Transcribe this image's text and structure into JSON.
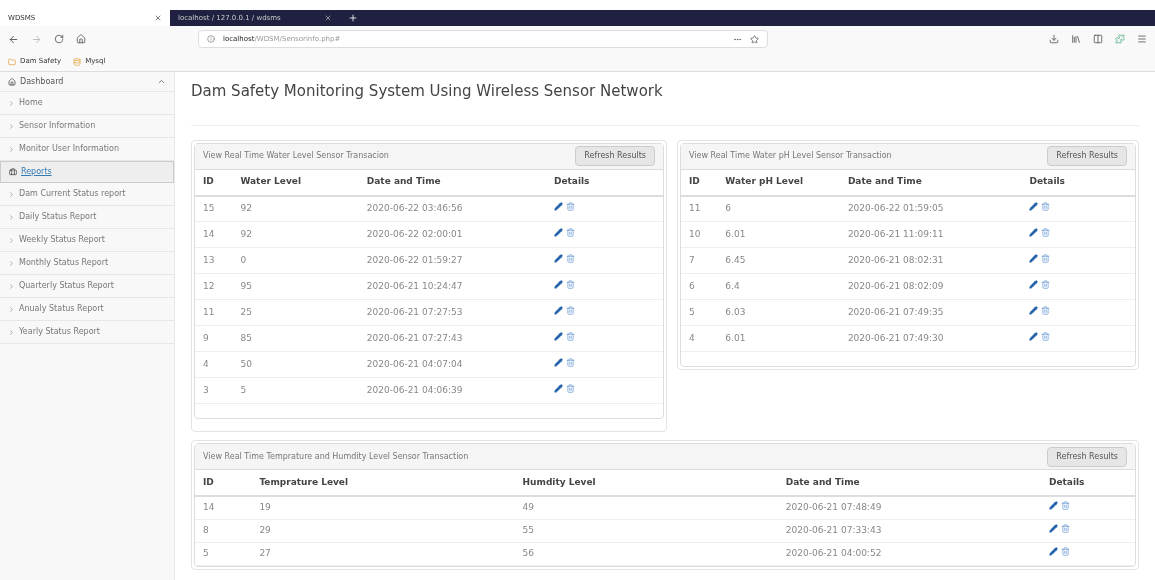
{
  "browser": {
    "tabs": [
      {
        "label": "WDSMS",
        "selected": true
      },
      {
        "label": "localhost / 127.0.0.1 / wdsms",
        "selected": false
      }
    ],
    "address": {
      "host": "localhost",
      "path": "/WDSM/Sensorinfo.php#"
    },
    "bookmarks": [
      "Dam Safety",
      "Mysql"
    ]
  },
  "sidebar": {
    "sections": [
      {
        "label": "Dashboard",
        "selected": false,
        "expanded": true,
        "items": [
          "Home",
          "Sensor Information",
          "Monitor User Information"
        ]
      },
      {
        "label": "Reports",
        "selected": true,
        "items": [
          "Dam Current Status report",
          "Daily Status Report",
          "Weekly Status Report",
          "Monthly Status Report",
          "Quarterly Status Report",
          "Anualy Status Report",
          "Yearly Status Report"
        ]
      }
    ]
  },
  "page_title": "Dam Safety Monitoring System Using Wireless Sensor Network",
  "panels": [
    {
      "title": "View Real Time Water Level Sensor Transacion",
      "button": "Refresh Results",
      "columns": [
        "ID",
        "Water Level",
        "Date and Time",
        "Details"
      ],
      "rows": [
        [
          "15",
          "92",
          "2020-06-22 03:46:56"
        ],
        [
          "14",
          "92",
          "2020-06-22 02:00:01"
        ],
        [
          "13",
          "0",
          "2020-06-22 01:59:27"
        ],
        [
          "12",
          "95",
          "2020-06-21 10:24:47"
        ],
        [
          "11",
          "25",
          "2020-06-21 07:27:53"
        ],
        [
          "9",
          "85",
          "2020-06-21 07:27:43"
        ],
        [
          "4",
          "50",
          "2020-06-21 04:07:04"
        ],
        [
          "3",
          "5",
          "2020-06-21 04:06:39"
        ]
      ]
    },
    {
      "title": "View Real Time Water pH Level Sensor Transaction",
      "button": "Refresh Results",
      "columns": [
        "ID",
        "Water pH Level",
        "Date and Time",
        "Details"
      ],
      "rows": [
        [
          "11",
          "6",
          "2020-06-22 01:59:05"
        ],
        [
          "10",
          "6.01",
          "2020-06-21 11:09:11"
        ],
        [
          "7",
          "6.45",
          "2020-06-21 08:02:31"
        ],
        [
          "6",
          "6.4",
          "2020-06-21 08:02:09"
        ],
        [
          "5",
          "6.03",
          "2020-06-21 07:49:35"
        ],
        [
          "4",
          "6.01",
          "2020-06-21 07:49:30"
        ]
      ]
    },
    {
      "title": "View Real Time Temprature and Humdity Level Sensor Transaction",
      "button": "Refresh Results",
      "columns": [
        "ID",
        "Temprature Level",
        "Humdity Level",
        "Date and Time",
        "Details"
      ],
      "rows": [
        [
          "14",
          "19",
          "49",
          "2020-06-21 07:48:49"
        ],
        [
          "8",
          "29",
          "55",
          "2020-06-21 07:33:43"
        ],
        [
          "5",
          "27",
          "56",
          "2020-06-21 04:00:52"
        ]
      ]
    }
  ]
}
